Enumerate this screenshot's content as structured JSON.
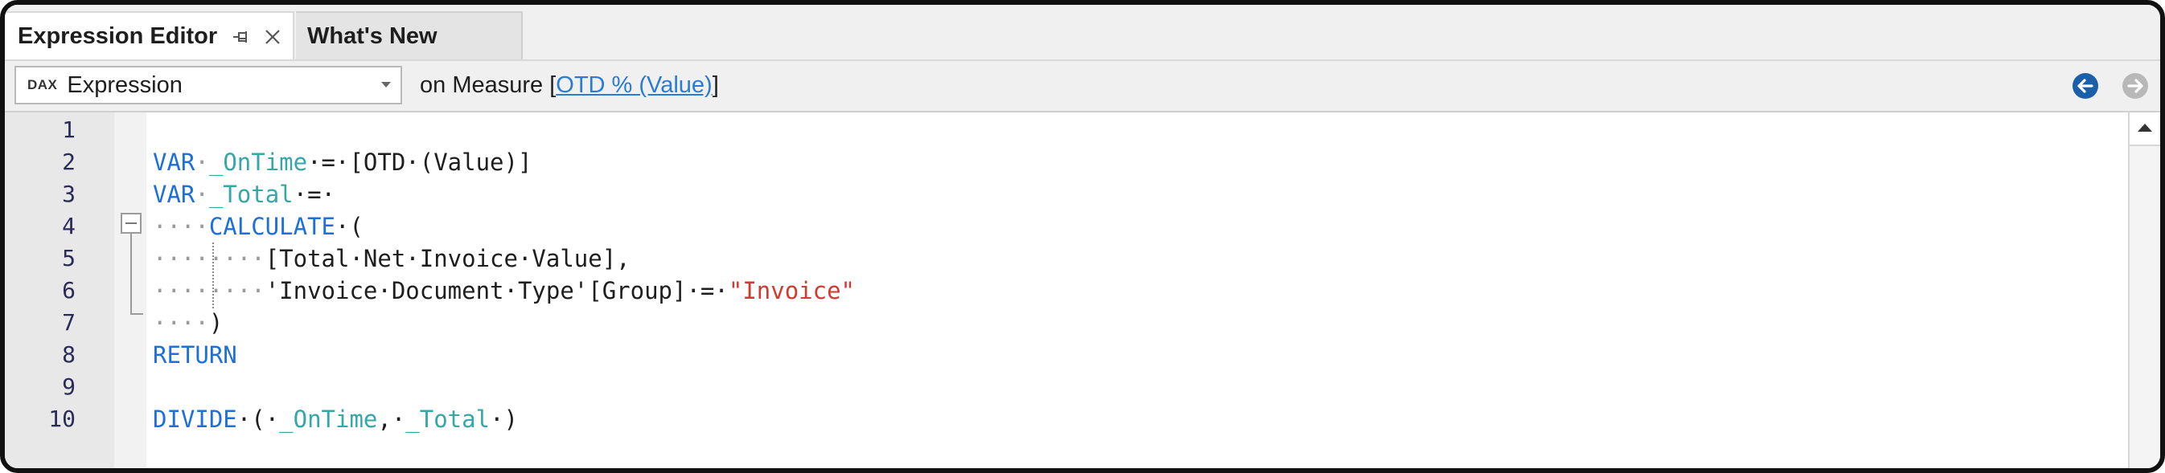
{
  "tabs": [
    {
      "label": "Expression Editor",
      "active": true
    },
    {
      "label": "What's New",
      "active": false
    }
  ],
  "toolbar": {
    "language_badge": "DAX",
    "language_value": "Expression",
    "measure_prefix": "on Measure [",
    "measure_name": "OTD % (Value)",
    "measure_suffix": "]"
  },
  "editor": {
    "line_numbers": [
      "1",
      "2",
      "3",
      "4",
      "5",
      "6",
      "7",
      "8",
      "9",
      "10"
    ],
    "code": {
      "l2_kw": "VAR",
      "l2_var": "_OnTime",
      "l2_rest": "·=·[OTD·(Value)]",
      "l3_kw": "VAR",
      "l3_var": "_Total",
      "l3_rest": "·=·",
      "l4_ws": "····",
      "l4_kw": "CALCULATE",
      "l4_rest": "·(",
      "l5_ws": "········",
      "l5_rest": "[Total·Net·Invoice·Value],",
      "l6_ws": "········",
      "l6_rest": "'Invoice·Document·Type'[Group]·=·",
      "l6_str": "\"Invoice\"",
      "l7_ws": "····",
      "l7_rest": ")",
      "l8_kw": "RETURN",
      "l10_kw": "DIVIDE",
      "l10_a": "·(·",
      "l10_var1": "_OnTime",
      "l10_b": ",·",
      "l10_var2": "_Total",
      "l10_c": "·)"
    }
  },
  "colors": {
    "keyword": "#1e6fd9",
    "variable": "#35a7a8",
    "string": "#d13a2f",
    "link": "#2a7bd1",
    "nav_active": "#1a5fa8",
    "nav_disabled": "#b8b8b8"
  },
  "icons": {
    "pin": "pin-icon",
    "close": "close-icon",
    "back": "arrow-left-circle-icon",
    "forward": "arrow-right-circle-icon"
  }
}
